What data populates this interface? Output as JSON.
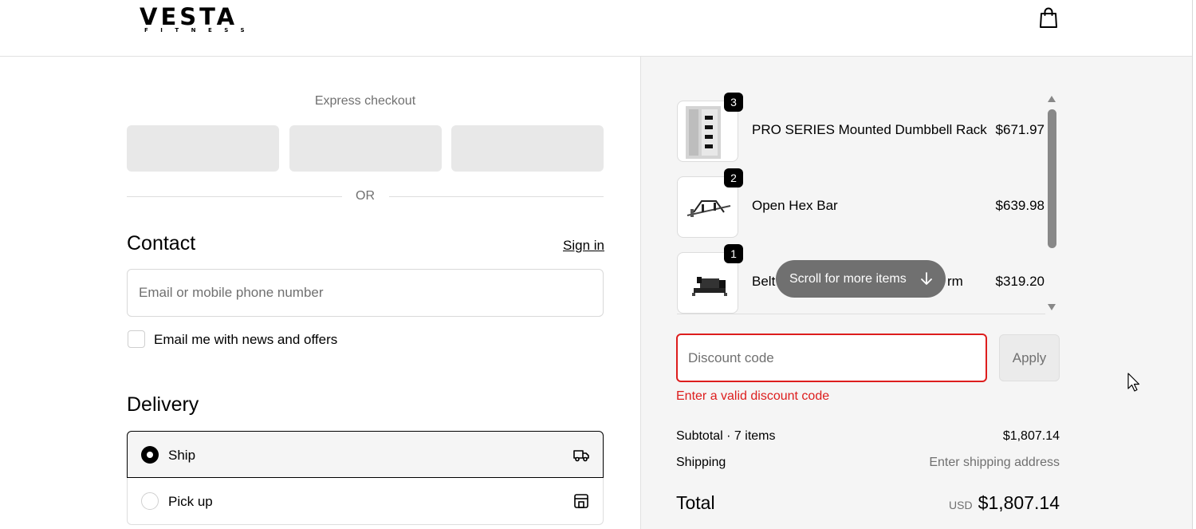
{
  "header": {
    "logo_main": "VESTA",
    "logo_sub": "FITNESS",
    "cart_icon": "shopping-bag-icon"
  },
  "express": {
    "title": "Express checkout",
    "or_label": "OR"
  },
  "contact": {
    "heading": "Contact",
    "sign_in": "Sign in",
    "email_placeholder": "Email or mobile phone number",
    "email_value": "",
    "newsletter_label": "Email me with news and offers",
    "newsletter_checked": false
  },
  "delivery": {
    "heading": "Delivery",
    "options": [
      {
        "label": "Ship",
        "selected": true,
        "icon": "truck-icon"
      },
      {
        "label": "Pick up",
        "selected": false,
        "icon": "store-icon"
      }
    ]
  },
  "order": {
    "items": [
      {
        "qty": "3",
        "name": "PRO SERIES Mounted Dumbbell Rack",
        "price": "$671.97"
      },
      {
        "qty": "2",
        "name": "Open Hex Bar",
        "price": "$639.98"
      },
      {
        "qty": "1",
        "name_visible_start": "Belt",
        "name_visible_end": "rm",
        "price": "$319.20"
      }
    ],
    "scroll_hint": "Scroll for more items"
  },
  "discount": {
    "placeholder": "Discount code",
    "value": "",
    "apply_label": "Apply",
    "error": "Enter a valid discount code"
  },
  "summary": {
    "subtotal_label": "Subtotal · 7 items",
    "subtotal_value": "$1,807.14",
    "shipping_label": "Shipping",
    "shipping_value": "Enter shipping address",
    "total_label": "Total",
    "total_currency": "USD",
    "total_value": "$1,807.14"
  },
  "colors": {
    "error": "#dd1d1d",
    "panel_bg": "#f5f5f5",
    "muted_text": "#707070"
  }
}
